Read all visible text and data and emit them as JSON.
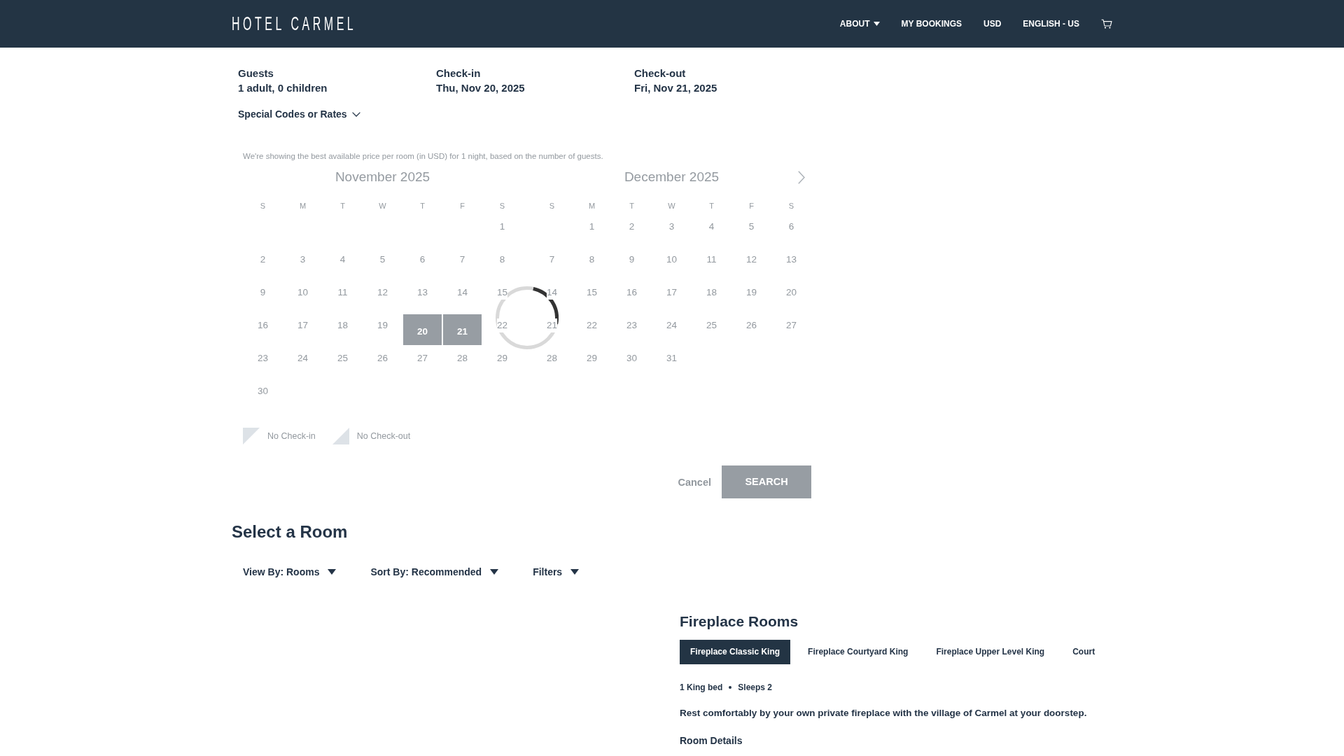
{
  "header": {
    "logo": "HOTEL CARMEL",
    "nav": [
      {
        "kind": "dropdown",
        "label": "ABOUT"
      },
      {
        "kind": "link",
        "label": "MY BOOKINGS"
      },
      {
        "kind": "link",
        "label": "USD"
      },
      {
        "kind": "link",
        "label": "ENGLISH - US"
      },
      {
        "kind": "cart"
      }
    ]
  },
  "search": {
    "fields": [
      {
        "label": "Guests",
        "value": "1 adult, 0 children"
      },
      {
        "label": "Check-in",
        "value": "Thu, Nov 20, 2025"
      },
      {
        "label": "Check-out",
        "value": "Fri, Nov 21, 2025"
      }
    ],
    "special_codes": {
      "label": "Special Codes or Rates",
      "expanded": false
    }
  },
  "calendar": {
    "disabled": true,
    "loading": true,
    "note": "We're showing the best available price per room (in USD) for 1 night, based on the number of guests.",
    "months": [
      {
        "title": "November 2025",
        "weekdays": [
          "S",
          "M",
          "T",
          "W",
          "T",
          "F",
          "S"
        ],
        "weeks": [
          [
            {
              "day": "1",
              "selected": false
            }
          ],
          [
            {
              "day": "2",
              "selected": false
            },
            {
              "day": "3",
              "selected": false
            },
            {
              "day": "4",
              "selected": false
            },
            {
              "day": "5",
              "selected": false
            },
            {
              "day": "6",
              "selected": false
            },
            {
              "day": "7",
              "selected": false
            },
            {
              "day": "8",
              "selected": false
            }
          ],
          [
            {
              "day": "9",
              "selected": false
            },
            {
              "day": "10",
              "selected": false
            },
            {
              "day": "11",
              "selected": false
            },
            {
              "day": "12",
              "selected": false
            },
            {
              "day": "13",
              "selected": false
            },
            {
              "day": "14",
              "selected": false
            },
            {
              "day": "15",
              "selected": false
            }
          ],
          [
            {
              "day": "16",
              "selected": false
            },
            {
              "day": "17",
              "selected": false
            },
            {
              "day": "18",
              "selected": false
            },
            {
              "day": "19",
              "selected": false
            },
            {
              "day": "20",
              "selected": true
            },
            {
              "day": "21",
              "selected": true
            },
            {
              "day": "22",
              "selected": false
            }
          ],
          [
            {
              "day": "23",
              "selected": false
            },
            {
              "day": "24",
              "selected": false
            },
            {
              "day": "25",
              "selected": false
            },
            {
              "day": "26",
              "selected": false
            },
            {
              "day": "27",
              "selected": false
            },
            {
              "day": "28",
              "selected": false
            },
            {
              "day": "29",
              "selected": false
            }
          ],
          [
            {
              "day": "30",
              "selected": false
            }
          ]
        ]
      },
      {
        "title": "December 2025",
        "weekdays": [
          "S",
          "M",
          "T",
          "W",
          "T",
          "F",
          "S"
        ],
        "weeks": [
          [
            {
              "day": "1",
              "selected": false
            },
            {
              "day": "2",
              "selected": false
            },
            {
              "day": "3",
              "selected": false
            },
            {
              "day": "4",
              "selected": false
            },
            {
              "day": "5",
              "selected": false
            },
            {
              "day": "6",
              "selected": false
            }
          ],
          [
            {
              "day": "7",
              "selected": false
            },
            {
              "day": "8",
              "selected": false
            },
            {
              "day": "9",
              "selected": false
            },
            {
              "day": "10",
              "selected": false
            },
            {
              "day": "11",
              "selected": false
            },
            {
              "day": "12",
              "selected": false
            },
            {
              "day": "13",
              "selected": false
            }
          ],
          [
            {
              "day": "14",
              "selected": false
            },
            {
              "day": "15",
              "selected": false
            },
            {
              "day": "16",
              "selected": false
            },
            {
              "day": "17",
              "selected": false
            },
            {
              "day": "18",
              "selected": false
            },
            {
              "day": "19",
              "selected": false
            },
            {
              "day": "20",
              "selected": false
            }
          ],
          [
            {
              "day": "21",
              "selected": false
            },
            {
              "day": "22",
              "selected": false
            },
            {
              "day": "23",
              "selected": false
            },
            {
              "day": "24",
              "selected": false
            },
            {
              "day": "25",
              "selected": false
            },
            {
              "day": "26",
              "selected": false
            },
            {
              "day": "27",
              "selected": false
            }
          ],
          [
            {
              "day": "28",
              "selected": false
            },
            {
              "day": "29",
              "selected": false
            },
            {
              "day": "30",
              "selected": false
            },
            {
              "day": "31",
              "selected": false
            }
          ]
        ]
      }
    ],
    "legend": [
      {
        "kind": "no-check-in",
        "label": "No Check-in"
      },
      {
        "kind": "no-check-out",
        "label": "No Check-out"
      }
    ],
    "actions": [
      {
        "kind": "link",
        "label": "Cancel"
      },
      {
        "kind": "primary",
        "label": "SEARCH"
      }
    ]
  },
  "rooms": {
    "title": "Select a Room",
    "controls": [
      "View By: Rooms",
      "Sort By: Recommended",
      "Filters"
    ],
    "category": {
      "title": "Fireplace Rooms",
      "tabs": [
        {
          "label": "Fireplace Classic King",
          "selected": true
        },
        {
          "label": "Fireplace Courtyard King",
          "selected": false
        },
        {
          "label": "Fireplace Upper Level King",
          "selected": false
        },
        {
          "label": "Court",
          "selected": false
        }
      ],
      "features": [
        "1 King bed",
        "Sleeps 2"
      ],
      "description": "Rest comfortably by your own private fireplace with the village of Carmel at your doorstep.",
      "details_link": "Room Details"
    }
  }
}
